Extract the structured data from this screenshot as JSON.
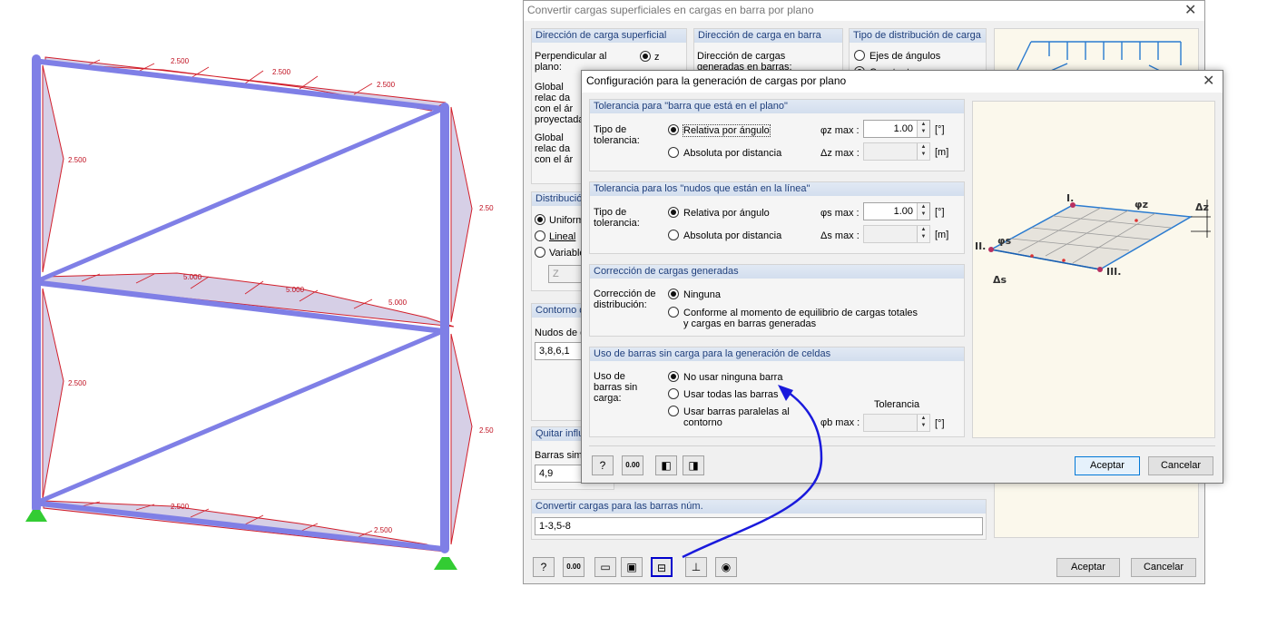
{
  "structure": {
    "load_labels": [
      "2.500",
      "2.500",
      "2.500",
      "2.500",
      "2.50",
      "5.000",
      "5.000",
      "5.000",
      "2.500",
      "2.50",
      "2.500",
      "2.500"
    ]
  },
  "main_dialog": {
    "title": "Convertir cargas superficiales en cargas en barra por plano",
    "load_direction": {
      "header": "Dirección de carga superficial",
      "perpendicular_label": "Perpendicular al plano:",
      "z_label": "z",
      "global_1": "Global relac da con el ár proyectada",
      "global_2": "Global relac da con el ár"
    },
    "member_direction": {
      "header": "Dirección de carga en barra",
      "text": "Dirección de cargas generadas en barras:"
    },
    "distribution_type": {
      "header": "Tipo de distribución de carga",
      "option_1": "Ejes de ángulos",
      "option_2": "Constante"
    },
    "distribution": {
      "header": "Distribució",
      "options": [
        "Uniforme",
        "Lineal",
        "Variable"
      ],
      "select_value": "Z"
    },
    "contour": {
      "header": "Contorno d",
      "nodes_label": "Nudos de e",
      "nodes_value": "3,8,6,1"
    },
    "remove_influence": {
      "header": "Quitar influe",
      "members_label": "Barras simp",
      "members_value": "4,9"
    },
    "convert": {
      "header": "Convertir cargas para las barras núm.",
      "value": "1-3,5-8"
    },
    "toolbar_icons": [
      "help-icon",
      "decimal-icon",
      "open-icon",
      "save-icon",
      "generation-settings-icon",
      "axis-icon",
      "view-icon"
    ],
    "decimal_text": "0.00",
    "accept": "Aceptar",
    "cancel": "Cancelar"
  },
  "cfg_dialog": {
    "title": "Configuración para la generación de cargas por plano",
    "tol_member": {
      "header": "Tolerancia para \"barra que está en el plano\"",
      "type_label": "Tipo de tolerancia:",
      "opt_relative": "Relativa por ángulo",
      "opt_absolute": "Absoluta por distancia",
      "phi_label": "φz max :",
      "phi_value": "1.00",
      "phi_unit": "[°]",
      "delta_label": "Δz max :",
      "delta_value": "",
      "delta_unit": "[m]"
    },
    "tol_nodes": {
      "header": "Tolerancia para los \"nudos que están en la línea\"",
      "type_label": "Tipo de tolerancia:",
      "opt_relative": "Relativa por ángulo",
      "opt_absolute": "Absoluta por distancia",
      "phi_label": "φs max :",
      "phi_value": "1.00",
      "phi_unit": "[°]",
      "delta_label": "Δs max :",
      "delta_value": "",
      "delta_unit": "[m]"
    },
    "correction": {
      "header": "Corrección de cargas generadas",
      "label": "Corrección de distribución:",
      "opt_none": "Ninguna",
      "opt_equilibrium": "Conforme al momento de equilibrio de cargas totales y cargas en barras generadas"
    },
    "unloaded": {
      "header": "Uso de barras sin carga para la generación de celdas",
      "label": "Uso de barras sin carga:",
      "opt_none": "No usar ninguna barra",
      "opt_all": "Usar todas las barras",
      "opt_parallel": "Usar barras paralelas al contorno",
      "tolerance_label": "Tolerancia",
      "phi_label": "φb max :",
      "phi_value": "",
      "phi_unit": "[°]"
    },
    "diagram_labels": [
      "I.",
      "II.",
      "III.",
      "φz",
      "φs",
      "Δz",
      "Δs"
    ],
    "decimal_text": "0.00",
    "accept": "Aceptar",
    "cancel": "Cancelar"
  }
}
